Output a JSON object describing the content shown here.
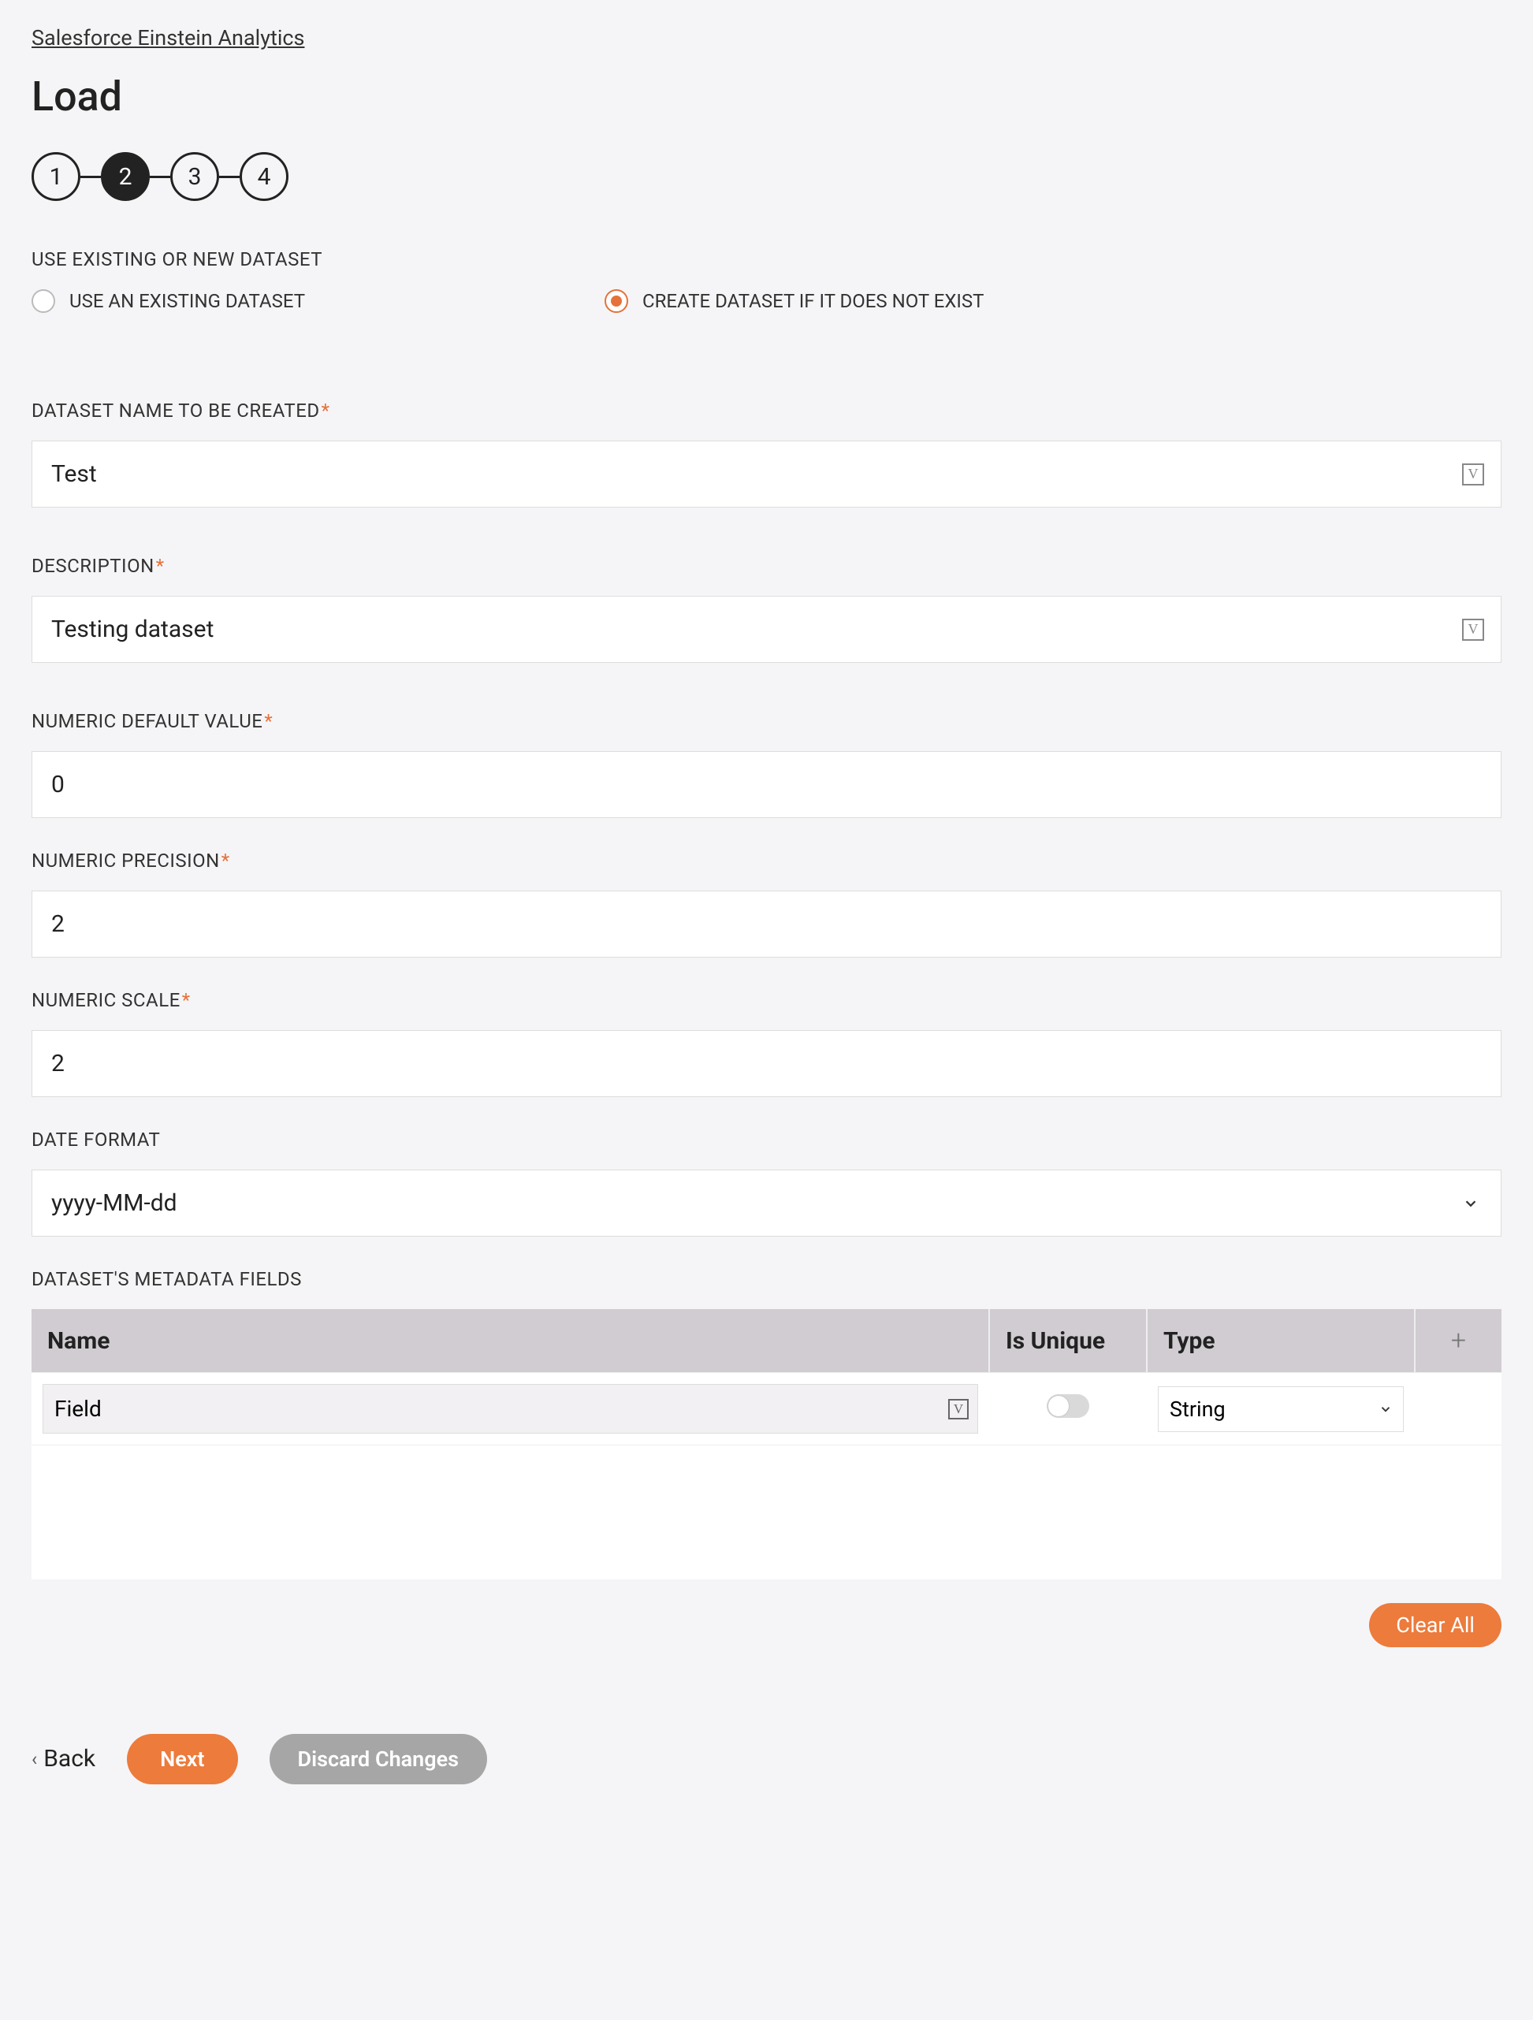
{
  "breadcrumb": "Salesforce Einstein Analytics",
  "page_title": "Load",
  "stepper": {
    "current": 2,
    "steps": [
      "1",
      "2",
      "3",
      "4"
    ]
  },
  "dataset_mode": {
    "label": "USE EXISTING OR NEW DATASET",
    "option_existing": "USE AN EXISTING DATASET",
    "option_create": "CREATE DATASET IF IT DOES NOT EXIST",
    "selected": "create"
  },
  "dataset_name": {
    "label": "DATASET NAME TO BE CREATED",
    "required": true,
    "value": "Test"
  },
  "description": {
    "label": "DESCRIPTION",
    "required": true,
    "value": "Testing dataset"
  },
  "numeric_default": {
    "label": "NUMERIC DEFAULT VALUE",
    "required": true,
    "value": "0"
  },
  "numeric_precision": {
    "label": "NUMERIC PRECISION",
    "required": true,
    "value": "2"
  },
  "numeric_scale": {
    "label": "NUMERIC SCALE",
    "required": true,
    "value": "2"
  },
  "date_format": {
    "label": "DATE FORMAT",
    "required": false,
    "value": "yyyy-MM-dd"
  },
  "metadata": {
    "label": "DATASET'S METADATA FIELDS",
    "columns": {
      "name": "Name",
      "is_unique": "Is Unique",
      "type": "Type"
    },
    "rows": [
      {
        "name": "Field",
        "is_unique": false,
        "type": "String"
      }
    ]
  },
  "buttons": {
    "clear_all": "Clear All",
    "back": "Back",
    "next": "Next",
    "discard": "Discard Changes"
  }
}
